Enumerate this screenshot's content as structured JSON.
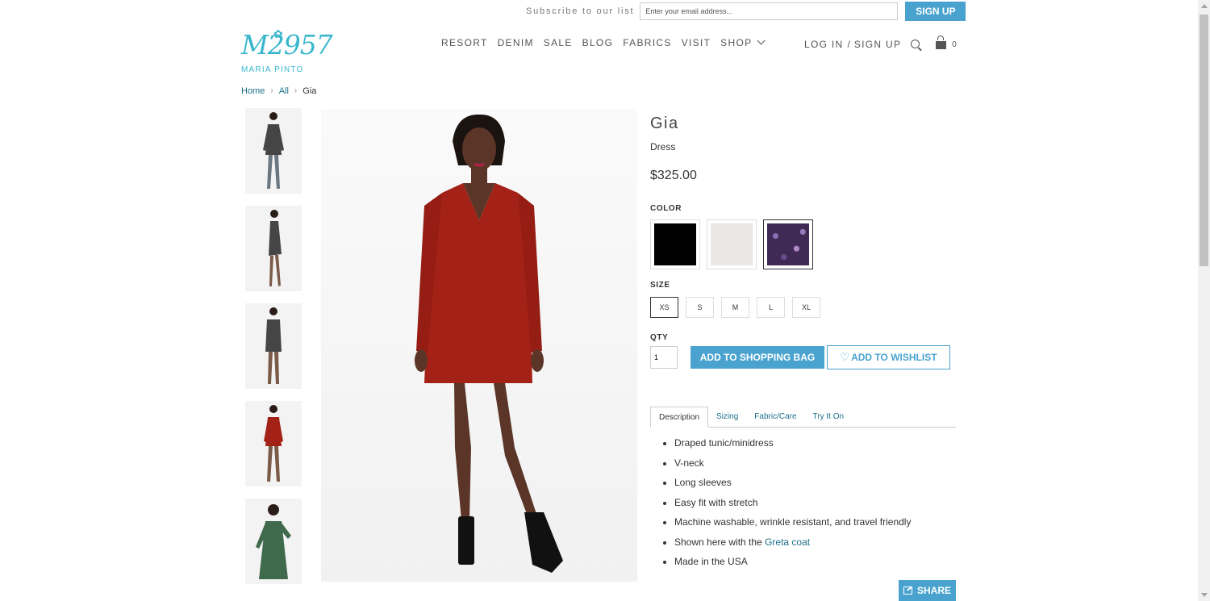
{
  "header": {
    "subscribe_label": "Subscribe to our list",
    "email_placeholder": "Enter your email address...",
    "signup_label": "SIGN UP",
    "logo_mark": "M2957",
    "logo_text": "MARIA PINTO",
    "nav": [
      "RESORT",
      "DENIM",
      "SALE",
      "BLOG",
      "FABRICS",
      "VISIT",
      "SHOP"
    ],
    "login_label": "LOG IN",
    "account_sep": "/",
    "signup_link": "SIGN UP",
    "cart_count": "0"
  },
  "breadcrumb": {
    "home": "Home",
    "all": "All",
    "current": "Gia"
  },
  "product": {
    "title": "Gia",
    "subtitle": "Dress",
    "price": "$325.00",
    "color_label": "COLOR",
    "colors": [
      {
        "name": "black",
        "hex": "#000000"
      },
      {
        "name": "ivory",
        "hex": "#e9e6e3"
      },
      {
        "name": "purple print",
        "hex": "#3e2a55"
      }
    ],
    "size_label": "SIZE",
    "sizes": [
      "XS",
      "S",
      "M",
      "L",
      "XL"
    ],
    "selected_size": "XS",
    "qty_label": "QTY",
    "qty_value": "1",
    "add_bag_label": "ADD TO SHOPPING BAG",
    "add_wish_label": "ADD TO WISHLIST"
  },
  "tabs": [
    "Description",
    "Sizing",
    "Fabric/Care",
    "Try It On"
  ],
  "description": {
    "items": [
      "Draped tunic/minidress",
      "V-neck",
      "Long sleeves",
      "Easy fit with stretch",
      "Machine washable, wrinkle resistant, and travel friendly",
      "Shown here with the ",
      "Made in the USA"
    ],
    "link_text": "Greta coat"
  },
  "share_label": "SHARE",
  "colors": {
    "accent": "#4aa3cf",
    "link": "#1c6f8a",
    "logo": "#38b7cc",
    "dress_red": "#a32116"
  },
  "thumbnails": [
    {
      "dress": "#454545"
    },
    {
      "dress": "#454545"
    },
    {
      "dress": "#454545"
    },
    {
      "dress": "#a32116"
    },
    {
      "dress": "#3f6a4c"
    }
  ]
}
